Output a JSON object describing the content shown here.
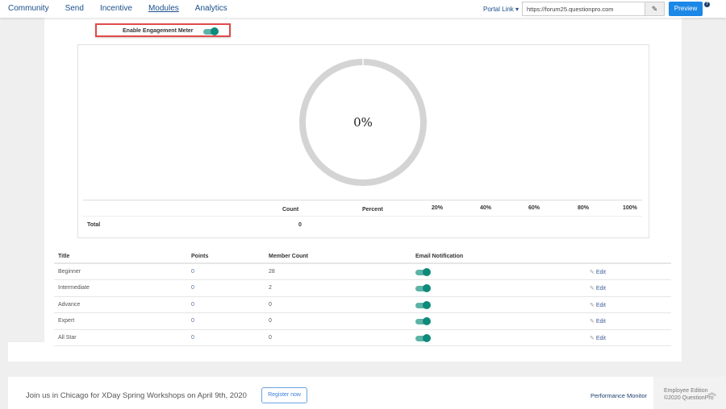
{
  "nav": {
    "items": [
      "Community",
      "Send",
      "Incentive",
      "Modules",
      "Analytics"
    ],
    "active": "Modules"
  },
  "portal": {
    "label": "Portal Link",
    "url": "https://forum25.questionpro.com",
    "preview": "Preview",
    "help": "?"
  },
  "engagement": {
    "label": "Enable Engagement Meter",
    "enabled": true,
    "percent_label": "0%",
    "percent": 0
  },
  "stats": {
    "headers": {
      "count": "Count",
      "percent": "Percent"
    },
    "scale": [
      "20%",
      "40%",
      "60%",
      "80%",
      "100%"
    ],
    "total_label": "Total",
    "total_count": "0"
  },
  "levels": {
    "headers": [
      "Title",
      "Points",
      "Member Count",
      "Email Notification"
    ],
    "rows": [
      {
        "title": "Beginner",
        "points": "0",
        "members": "28",
        "email": true,
        "edit": "Edit"
      },
      {
        "title": "Intermediate",
        "points": "0",
        "members": "2",
        "email": true,
        "edit": "Edit"
      },
      {
        "title": "Advance",
        "points": "0",
        "members": "0",
        "email": true,
        "edit": "Edit"
      },
      {
        "title": "Expert",
        "points": "0",
        "members": "0",
        "email": true,
        "edit": "Edit"
      },
      {
        "title": "All Star",
        "points": "0",
        "members": "0",
        "email": true,
        "edit": "Edit"
      }
    ]
  },
  "footer": {
    "promo": "Join us in Chicago for XDay Spring Workshops on April 9th, 2020",
    "register": "Register now",
    "perf": "Performance Monitor",
    "edition": "Employee Edition",
    "copyright": "©2020 QuestionPro"
  },
  "colors": {
    "accent": "#1b87e6",
    "toggle": "#0e8a7a",
    "highlight": "#e24a4a"
  }
}
